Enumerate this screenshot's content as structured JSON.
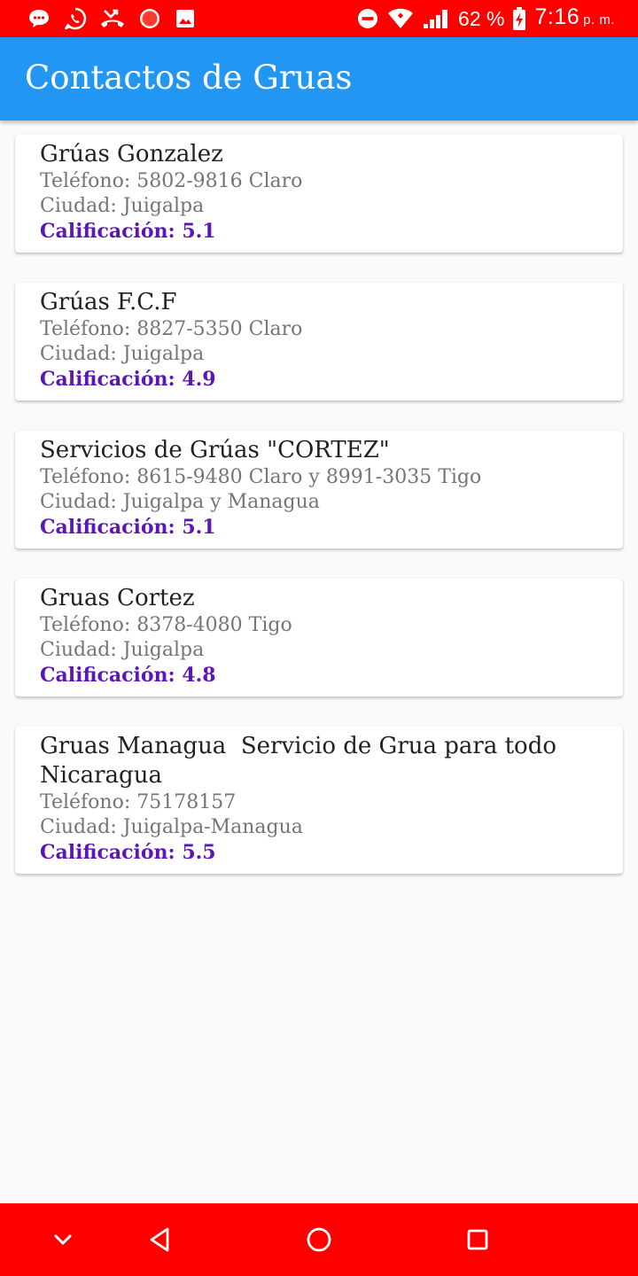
{
  "status_bar": {
    "left_icons": [
      "chat-bubble-icon",
      "whatsapp-icon",
      "missed-call-icon",
      "red-circle-icon",
      "image-icon"
    ],
    "right_icons": [
      "do-not-disturb-icon",
      "wifi-icon",
      "signal-icon",
      "battery-charging-icon"
    ],
    "battery": "62 %",
    "time": "7:16",
    "ampm": "p. m.",
    "background": "#ff0000"
  },
  "app_bar": {
    "title": "Contactos de Gruas",
    "background": "#2196f3"
  },
  "contacts": [
    {
      "name": "Grúas Gonzalez",
      "phone": "Teléfono: 5802-9816 Claro",
      "city": "Ciudad: Juigalpa",
      "rating": "Calificación: 5.1"
    },
    {
      "name": "Grúas F.C.F",
      "phone": "Teléfono: 8827-5350 Claro",
      "city": "Ciudad: Juigalpa",
      "rating": "Calificación: 4.9"
    },
    {
      "name": "Servicios de Grúas \"CORTEZ\"",
      "phone": "Teléfono: 8615-9480 Claro y 8991-3035 Tigo",
      "city": "Ciudad: Juigalpa y Managua",
      "rating": "Calificación: 5.1"
    },
    {
      "name": "Gruas Cortez",
      "phone": "Teléfono: 8378-4080 Tigo",
      "city": "Ciudad: Juigalpa",
      "rating": "Calificación: 4.8"
    },
    {
      "name": "Gruas Managua  Servicio de Grua para todo Nicaragua",
      "phone": "Teléfono: 75178157",
      "city": "Ciudad: Juigalpa-Managua",
      "rating": "Calificación: 5.5"
    }
  ],
  "nav_bar": {
    "buttons": [
      "chevron-down-icon",
      "back-icon",
      "home-icon",
      "recents-icon"
    ],
    "background": "#ff0000"
  },
  "colors": {
    "rating": "#5b16b8",
    "secondary_text": "#757575",
    "primary_text": "#212121"
  }
}
